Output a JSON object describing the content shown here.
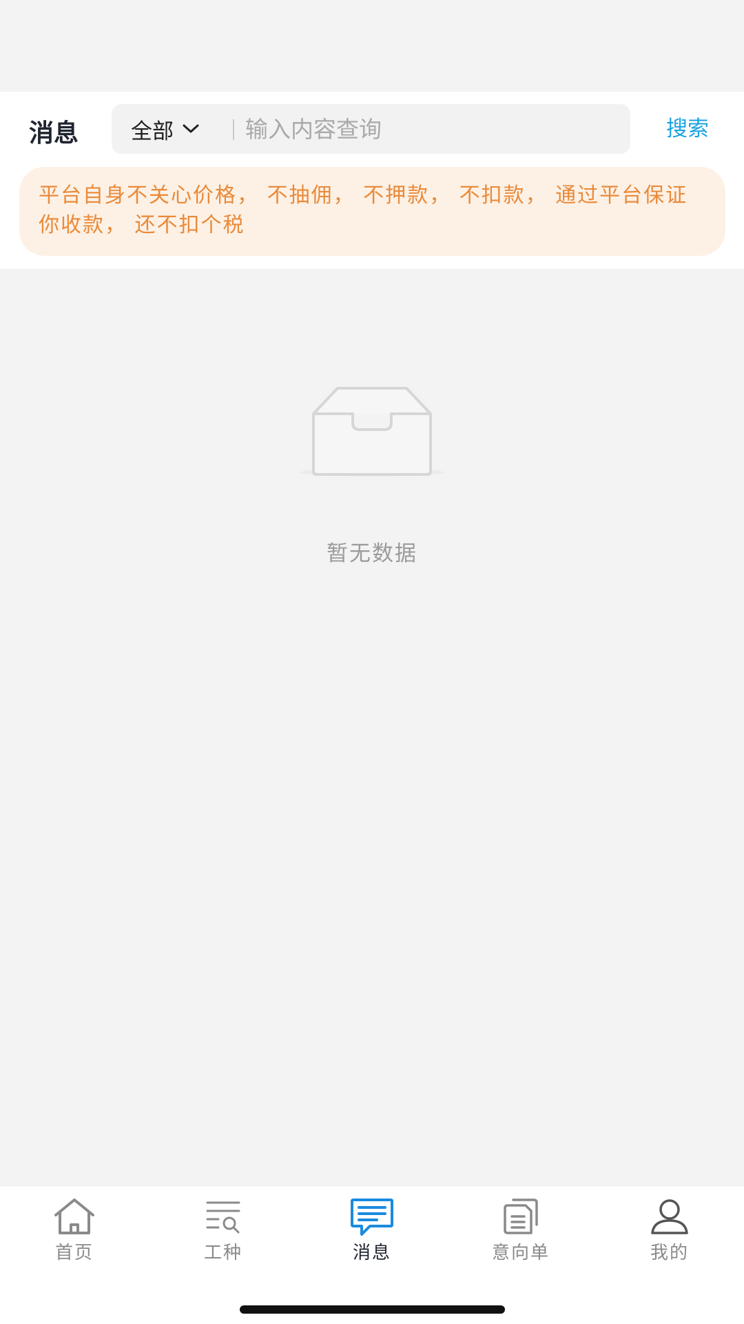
{
  "header": {
    "title": "消息",
    "filter_value": "全部",
    "search_placeholder": "输入内容查询",
    "search_button": "搜索"
  },
  "notice": "平台自身不关心价格， 不抽佣， 不押款， 不扣款， 通过平台保证你收款， 还不扣个税",
  "empty_state": {
    "icon": "inbox-icon",
    "text": "暂无数据"
  },
  "tabbar": {
    "tabs": [
      {
        "label": "首页",
        "icon": "home-icon"
      },
      {
        "label": "工种",
        "icon": "list-search-icon"
      },
      {
        "label": "消息",
        "icon": "message-icon",
        "active": true
      },
      {
        "label": "意向单",
        "icon": "document-icon"
      },
      {
        "label": "我的",
        "icon": "user-icon"
      }
    ]
  },
  "colors": {
    "accent": "#1a8be0",
    "search_link": "#1aa3e0",
    "notice_text": "#e98a3a",
    "notice_bg": "#fdf1e5"
  }
}
